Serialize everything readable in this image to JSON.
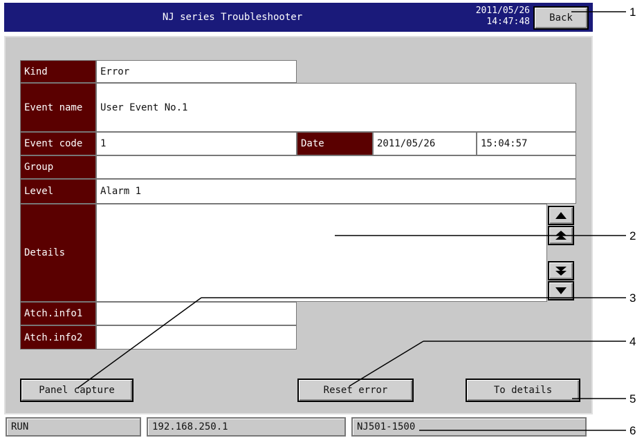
{
  "header": {
    "title": "NJ series Troubleshooter",
    "date": "2011/05/26",
    "time": "14:47:48",
    "back_label": "Back"
  },
  "event": {
    "kind_label": "Kind",
    "kind_value": "Error",
    "event_name_label": "Event name",
    "event_name_value": "User Event No.1",
    "event_code_label": "Event code",
    "event_code_value": "1",
    "date_label": "Date",
    "date_value": "2011/05/26",
    "time_value": "15:04:57",
    "group_label": "Group",
    "group_value": "",
    "level_label": "Level",
    "level_value": "Alarm 1",
    "details_label": "Details",
    "details_value": "",
    "atch1_label": "Atch.info1",
    "atch1_value": "",
    "atch2_label": "Atch.info2",
    "atch2_value": ""
  },
  "scroll_icons": [
    "scroll-up-icon",
    "scroll-top-icon",
    "scroll-bottom-icon",
    "scroll-down-icon"
  ],
  "buttons": {
    "panel_capture": "Panel capture",
    "reset_error": "Reset error",
    "to_details": "To details"
  },
  "status": {
    "mode": "RUN",
    "ip": "192.168.250.1",
    "model": "NJ501-1500"
  },
  "callouts": [
    "1",
    "2",
    "3",
    "4",
    "5",
    "6"
  ],
  "colors": {
    "title_bar": "#1a1a7a",
    "label_bg": "#5a0000",
    "panel_bg": "#c9c9c9"
  }
}
